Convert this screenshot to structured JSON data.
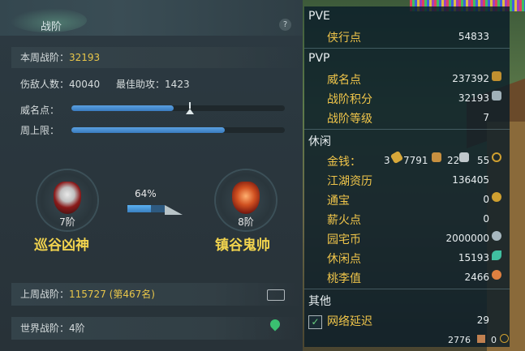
{
  "battle_panel": {
    "title": "战阶",
    "help": "?",
    "weekly_label": "本周战阶：",
    "weekly_value": "32193",
    "kills_label": "伤敌人数：",
    "kills_value": "40040",
    "assist_label": "最佳助攻：",
    "assist_value": "1423",
    "prestige_label": "威名点：",
    "prestige_progress": 0.48,
    "weekly_cap_label": "周上限：",
    "weekly_cap_progress": 0.72,
    "current_rank": {
      "rank": "7阶",
      "name": "巡谷凶神"
    },
    "next_rank": {
      "rank": "8阶",
      "name": "镇谷鬼帅"
    },
    "progress_percent": "64%",
    "progress_fraction": 0.64,
    "last_week_label": "上周战阶：",
    "last_week_value": "115727 (第467名)",
    "world_label": "世界战阶：",
    "world_value": "4阶"
  },
  "stats_panel": {
    "pve": {
      "title": "PVE",
      "items": [
        {
          "label": "侠行点",
          "value": "54833"
        }
      ]
    },
    "pvp": {
      "title": "PVP",
      "items": [
        {
          "label": "威名点",
          "value": "237392"
        },
        {
          "label": "战阶积分",
          "value": "32193"
        },
        {
          "label": "战阶等级",
          "value": "7"
        }
      ]
    },
    "leisure": {
      "title": "休闲",
      "money_label": "金钱：",
      "money_gold": "3",
      "money_silver_big": "7791",
      "money_silver": "22",
      "money_copper": "55",
      "items": [
        {
          "label": "江湖资历",
          "value": "136405"
        },
        {
          "label": "通宝",
          "value": "0"
        },
        {
          "label": "薪火点",
          "value": "0"
        },
        {
          "label": "园宅币",
          "value": "2000000"
        },
        {
          "label": "休闲点",
          "value": "15193"
        },
        {
          "label": "桃李值",
          "value": "2466"
        }
      ]
    },
    "other": {
      "title": "其他",
      "items": [
        {
          "label": "网络延迟",
          "value": "29",
          "checked": true
        }
      ]
    },
    "bottom_value": "2776",
    "bottom_value2": "0"
  },
  "colors": {
    "gold": "#f0c54a",
    "accent_blue": "#4a90d0"
  },
  "icons": [
    "help-icon",
    "mask-icon",
    "chest-icon",
    "map-pin-icon",
    "gold-ingot-icon",
    "silver-icon",
    "coin-icon",
    "check-icon"
  ]
}
